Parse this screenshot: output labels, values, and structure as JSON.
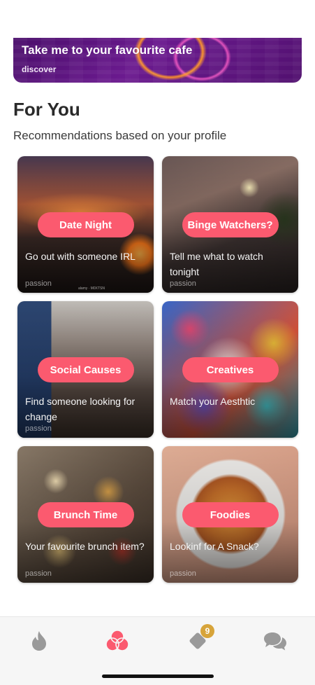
{
  "banner": {
    "title": "Take me to your favourite cafe",
    "subtitle": "discover"
  },
  "section": {
    "title": "For You",
    "subtitle": "Recommendations based on your profile"
  },
  "cards": [
    {
      "label": "Date Night",
      "description": "Go out with someone IRL",
      "tag": "passion",
      "credit": "alamy · M0XTSN",
      "scene": "sunset-bonfire"
    },
    {
      "label": "Binge Watchers?",
      "description": "Tell me what to watch tonight",
      "tag": "passion",
      "scene": "outdoor-movie"
    },
    {
      "label": "Social Causes",
      "description": "Find someone looking for change",
      "tag": "passion",
      "scene": "protest-march"
    },
    {
      "label": "Creatives",
      "description": "Match your Aesthtic",
      "tag": "",
      "scene": "paint-splash"
    },
    {
      "label": "Brunch Time",
      "description": "Your favourite brunch item?",
      "tag": "passion",
      "scene": "brunch-table"
    },
    {
      "label": "Foodies",
      "description": "Lookinf for A Snack?",
      "tag": "passion",
      "scene": "snack-bowl"
    }
  ],
  "nav": {
    "items": [
      {
        "name": "flame-icon",
        "active": false
      },
      {
        "name": "discover-circles-icon",
        "active": true
      },
      {
        "name": "diamond-icon",
        "active": false,
        "badge": "9"
      },
      {
        "name": "chat-bubbles-icon",
        "active": false
      }
    ]
  },
  "colors": {
    "accent": "#fb5a6f",
    "badge": "#d7a43a",
    "nav_inactive": "#9a9a9a"
  }
}
